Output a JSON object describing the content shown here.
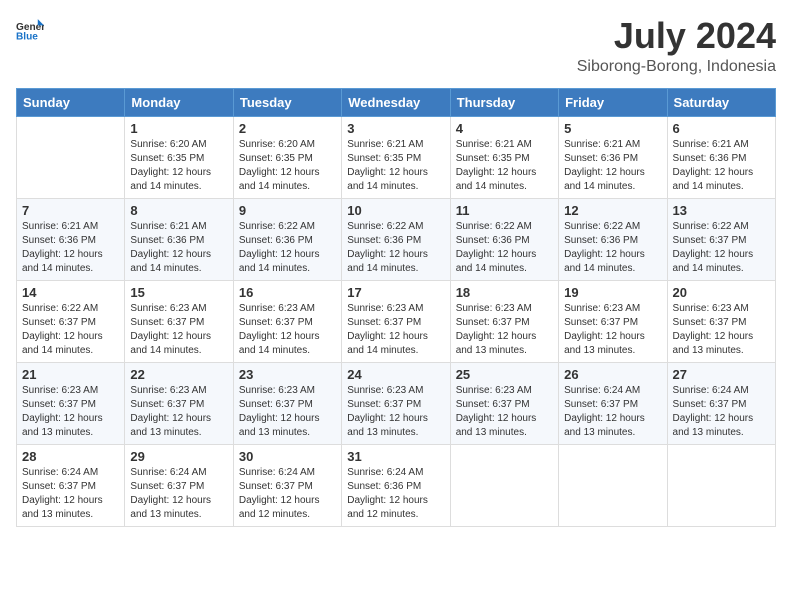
{
  "header": {
    "logo_line1": "General",
    "logo_line2": "Blue",
    "month_year": "July 2024",
    "location": "Siborong-Borong, Indonesia"
  },
  "weekdays": [
    "Sunday",
    "Monday",
    "Tuesday",
    "Wednesday",
    "Thursday",
    "Friday",
    "Saturday"
  ],
  "weeks": [
    [
      {
        "day": "",
        "sunrise": "",
        "sunset": "",
        "daylight": ""
      },
      {
        "day": "1",
        "sunrise": "6:20 AM",
        "sunset": "6:35 PM",
        "daylight": "12 hours and 14 minutes."
      },
      {
        "day": "2",
        "sunrise": "6:20 AM",
        "sunset": "6:35 PM",
        "daylight": "12 hours and 14 minutes."
      },
      {
        "day": "3",
        "sunrise": "6:21 AM",
        "sunset": "6:35 PM",
        "daylight": "12 hours and 14 minutes."
      },
      {
        "day": "4",
        "sunrise": "6:21 AM",
        "sunset": "6:35 PM",
        "daylight": "12 hours and 14 minutes."
      },
      {
        "day": "5",
        "sunrise": "6:21 AM",
        "sunset": "6:36 PM",
        "daylight": "12 hours and 14 minutes."
      },
      {
        "day": "6",
        "sunrise": "6:21 AM",
        "sunset": "6:36 PM",
        "daylight": "12 hours and 14 minutes."
      }
    ],
    [
      {
        "day": "7",
        "sunrise": "6:21 AM",
        "sunset": "6:36 PM",
        "daylight": "12 hours and 14 minutes."
      },
      {
        "day": "8",
        "sunrise": "6:21 AM",
        "sunset": "6:36 PM",
        "daylight": "12 hours and 14 minutes."
      },
      {
        "day": "9",
        "sunrise": "6:22 AM",
        "sunset": "6:36 PM",
        "daylight": "12 hours and 14 minutes."
      },
      {
        "day": "10",
        "sunrise": "6:22 AM",
        "sunset": "6:36 PM",
        "daylight": "12 hours and 14 minutes."
      },
      {
        "day": "11",
        "sunrise": "6:22 AM",
        "sunset": "6:36 PM",
        "daylight": "12 hours and 14 minutes."
      },
      {
        "day": "12",
        "sunrise": "6:22 AM",
        "sunset": "6:36 PM",
        "daylight": "12 hours and 14 minutes."
      },
      {
        "day": "13",
        "sunrise": "6:22 AM",
        "sunset": "6:37 PM",
        "daylight": "12 hours and 14 minutes."
      }
    ],
    [
      {
        "day": "14",
        "sunrise": "6:22 AM",
        "sunset": "6:37 PM",
        "daylight": "12 hours and 14 minutes."
      },
      {
        "day": "15",
        "sunrise": "6:23 AM",
        "sunset": "6:37 PM",
        "daylight": "12 hours and 14 minutes."
      },
      {
        "day": "16",
        "sunrise": "6:23 AM",
        "sunset": "6:37 PM",
        "daylight": "12 hours and 14 minutes."
      },
      {
        "day": "17",
        "sunrise": "6:23 AM",
        "sunset": "6:37 PM",
        "daylight": "12 hours and 14 minutes."
      },
      {
        "day": "18",
        "sunrise": "6:23 AM",
        "sunset": "6:37 PM",
        "daylight": "12 hours and 13 minutes."
      },
      {
        "day": "19",
        "sunrise": "6:23 AM",
        "sunset": "6:37 PM",
        "daylight": "12 hours and 13 minutes."
      },
      {
        "day": "20",
        "sunrise": "6:23 AM",
        "sunset": "6:37 PM",
        "daylight": "12 hours and 13 minutes."
      }
    ],
    [
      {
        "day": "21",
        "sunrise": "6:23 AM",
        "sunset": "6:37 PM",
        "daylight": "12 hours and 13 minutes."
      },
      {
        "day": "22",
        "sunrise": "6:23 AM",
        "sunset": "6:37 PM",
        "daylight": "12 hours and 13 minutes."
      },
      {
        "day": "23",
        "sunrise": "6:23 AM",
        "sunset": "6:37 PM",
        "daylight": "12 hours and 13 minutes."
      },
      {
        "day": "24",
        "sunrise": "6:23 AM",
        "sunset": "6:37 PM",
        "daylight": "12 hours and 13 minutes."
      },
      {
        "day": "25",
        "sunrise": "6:23 AM",
        "sunset": "6:37 PM",
        "daylight": "12 hours and 13 minutes."
      },
      {
        "day": "26",
        "sunrise": "6:24 AM",
        "sunset": "6:37 PM",
        "daylight": "12 hours and 13 minutes."
      },
      {
        "day": "27",
        "sunrise": "6:24 AM",
        "sunset": "6:37 PM",
        "daylight": "12 hours and 13 minutes."
      }
    ],
    [
      {
        "day": "28",
        "sunrise": "6:24 AM",
        "sunset": "6:37 PM",
        "daylight": "12 hours and 13 minutes."
      },
      {
        "day": "29",
        "sunrise": "6:24 AM",
        "sunset": "6:37 PM",
        "daylight": "12 hours and 13 minutes."
      },
      {
        "day": "30",
        "sunrise": "6:24 AM",
        "sunset": "6:37 PM",
        "daylight": "12 hours and 12 minutes."
      },
      {
        "day": "31",
        "sunrise": "6:24 AM",
        "sunset": "6:36 PM",
        "daylight": "12 hours and 12 minutes."
      },
      {
        "day": "",
        "sunrise": "",
        "sunset": "",
        "daylight": ""
      },
      {
        "day": "",
        "sunrise": "",
        "sunset": "",
        "daylight": ""
      },
      {
        "day": "",
        "sunrise": "",
        "sunset": "",
        "daylight": ""
      }
    ]
  ]
}
